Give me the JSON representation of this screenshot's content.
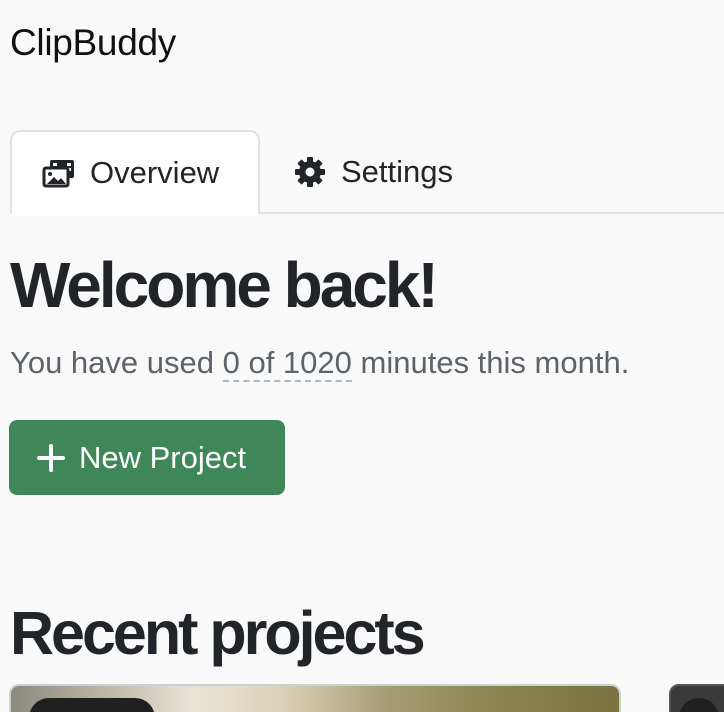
{
  "app": {
    "title": "ClipBuddy"
  },
  "tabs": [
    {
      "label": "Overview",
      "icon": "photo-film-icon",
      "active": true
    },
    {
      "label": "Settings",
      "icon": "gear-icon",
      "active": false
    }
  ],
  "main": {
    "heading": "Welcome back!",
    "usage_prefix": "You have used ",
    "usage_count": "0 of 1020",
    "usage_suffix": " minutes this month.",
    "usage_used": 0,
    "usage_total": 1020,
    "new_project_label": "New Project",
    "new_project_icon": "plus-icon",
    "new_project_color": "#3f8758"
  },
  "recent": {
    "heading": "Recent projects"
  }
}
